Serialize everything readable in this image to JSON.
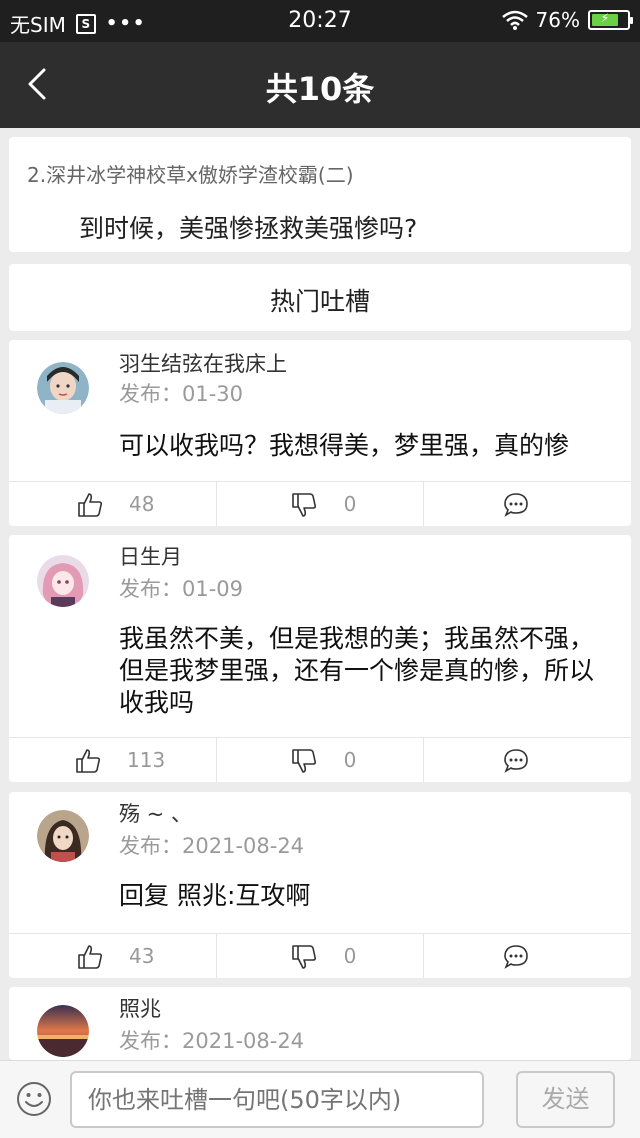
{
  "status_bar": {
    "carrier": "无SIM",
    "time": "20:27",
    "battery": "76%",
    "battery_level": 0.76
  },
  "navbar": {
    "title": "共10条"
  },
  "source": {
    "novel": "2.深井冰学神校草x傲娇学渣校霸(二)",
    "quote": "到时候，美强惨拯救美强惨吗?"
  },
  "hot_section": {
    "title": "热门吐槽"
  },
  "comments": [
    {
      "user": "羽生结弦在我床上",
      "date": "发布：01-30",
      "text": "可以收我吗？我想得美，梦里强，真的惨",
      "likes": "48",
      "dislikes": "0"
    },
    {
      "user": "日生月",
      "date": "发布：01-09",
      "text": "我虽然不美，但是我想的美；我虽然不强，但是我梦里强，还有一个惨是真的惨，所以收我吗",
      "likes": "113",
      "dislikes": "0"
    },
    {
      "user": "殇 ~ 、",
      "date": "发布：2021-08-24",
      "text": "回复 照兆:互攻啊",
      "likes": "43",
      "dislikes": "0"
    },
    {
      "user": "照兆",
      "date": "发布：2021-08-24"
    }
  ],
  "input": {
    "placeholder": "你也来吐槽一句吧(50字以内)"
  },
  "send_label": "发送",
  "colors": {
    "header": "#2e2e2e",
    "statusbar": "#1f1f1f",
    "battery": "#6ad045"
  }
}
